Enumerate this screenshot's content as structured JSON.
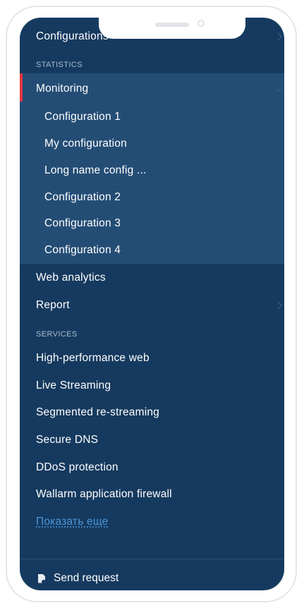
{
  "menu": {
    "top_item": "Configurations",
    "sections": {
      "statistics": "STATISTICS",
      "services": "SERVICES"
    },
    "monitoring": {
      "label": "Monitoring",
      "children": [
        "Configuration 1",
        "My configuration",
        "Long name config ...",
        "Configuration 2",
        "Configuration 3",
        "Configuration 4"
      ]
    },
    "web_analytics": "Web analytics",
    "report": "Report",
    "services": [
      "High-performance web",
      "Live Streaming",
      "Segmented re-streaming",
      "Secure DNS",
      "DDoS protection",
      "Wallarm application firewall"
    ],
    "show_more": "Показать еще"
  },
  "footer": {
    "send_request": "Send request"
  },
  "colors": {
    "background": "#163a5f",
    "expanded_background": "#244d75",
    "active_indicator": "#e6363f",
    "link": "#4a95d9"
  }
}
